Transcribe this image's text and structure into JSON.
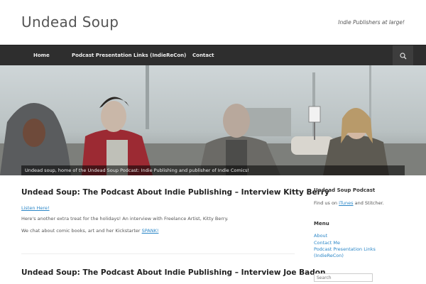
{
  "header": {
    "site_title": "Undead Soup",
    "tagline": "Indie Publishers at large!"
  },
  "nav": {
    "items": [
      {
        "label": "Home"
      },
      {
        "label": "Podcast Presentation Links (IndieReCon)"
      },
      {
        "label": "Contact"
      }
    ],
    "search_icon": "search-icon"
  },
  "hero": {
    "caption": "Undead soup, home of the Undead Soup Podcast: Indie Publishing and publisher of Indie Comics!"
  },
  "posts": [
    {
      "title": "Undead Soup: The Podcast About Indie Publishing – Interview Kitty Berry",
      "listen_link": "Listen Here!",
      "para1": "Here's another extra treat for the holidays! An interview with Freelance Artist, Kitty Berry.",
      "para2_text": "We chat about comic books, art and her Kickstarter ",
      "para2_link": "SPANK!"
    },
    {
      "title": "Undead Soup: The Podcast About Indie Publishing – Interview Joe Badon"
    }
  ],
  "sidebar": {
    "podcast_title": "Undead Soup Podcast",
    "find_us_prefix": "Find us on ",
    "itunes_link": "iTunes",
    "find_us_suffix": " and Stitcher.",
    "menu_title": "Menu",
    "menu_items": [
      {
        "label": "About"
      },
      {
        "label": "Contact Me"
      },
      {
        "label": "Podcast Presentation Links"
      },
      {
        "label": "(IndieReCon)"
      }
    ],
    "search_placeholder": "Search"
  }
}
